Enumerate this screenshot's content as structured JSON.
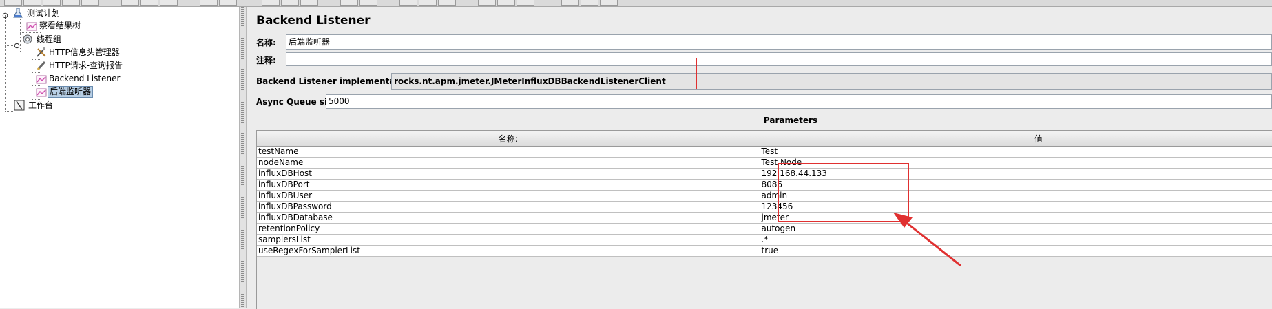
{
  "tree": {
    "items": [
      {
        "label": "测试计划"
      },
      {
        "label": "察看结果树"
      },
      {
        "label": "线程组"
      },
      {
        "label": "HTTP信息头管理器"
      },
      {
        "label": "HTTP请求-查询报告"
      },
      {
        "label": "Backend Listener"
      },
      {
        "label": "后端监听器"
      },
      {
        "label": "工作台"
      }
    ]
  },
  "panel": {
    "title": "Backend Listener",
    "name_label": "名称:",
    "name_value": "后端监听器",
    "comment_label": "注释:",
    "comment_value": "",
    "impl_label": "Backend Listener implementation",
    "impl_value": "rocks.nt.apm.jmeter.JMeterInfluxDBBackendListenerClient",
    "queue_label": "Async Queue size",
    "queue_value": "5000"
  },
  "parameters": {
    "title": "Parameters",
    "columns": [
      "名称:",
      "值"
    ],
    "rows": [
      {
        "name": "testName",
        "value": "Test"
      },
      {
        "name": "nodeName",
        "value": "Test Node"
      },
      {
        "name": "influxDBHost",
        "value": "192.168.44.133"
      },
      {
        "name": "influxDBPort",
        "value": "8086"
      },
      {
        "name": "influxDBUser",
        "value": "admin"
      },
      {
        "name": "influxDBPassword",
        "value": "123456"
      },
      {
        "name": "influxDBDatabase",
        "value": "jmeter"
      },
      {
        "name": "retentionPolicy",
        "value": "autogen"
      },
      {
        "name": "samplersList",
        "value": ".*"
      },
      {
        "name": "useRegexForSamplerList",
        "value": "true"
      }
    ]
  },
  "colors": {
    "annotation": "#e03030",
    "selection": "#b8cfe5"
  }
}
